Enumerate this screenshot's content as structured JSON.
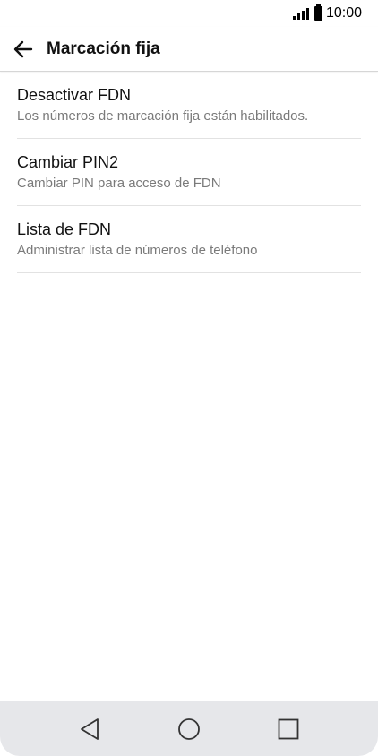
{
  "status_bar": {
    "time": "10:00",
    "signal_icon": "signal-icon",
    "battery_icon": "battery-icon"
  },
  "app_bar": {
    "back_icon": "arrow-back-icon",
    "title": "Marcación fija"
  },
  "items": [
    {
      "title": "Desactivar FDN",
      "subtitle": "Los números de marcación fija están habilitados."
    },
    {
      "title": "Cambiar PIN2",
      "subtitle": "Cambiar PIN para acceso de FDN"
    },
    {
      "title": "Lista de FDN",
      "subtitle": "Administrar lista de números de teléfono"
    }
  ],
  "nav_bar": {
    "back_icon": "triangle-back-icon",
    "home_icon": "circle-home-icon",
    "recents_icon": "square-recents-icon"
  }
}
